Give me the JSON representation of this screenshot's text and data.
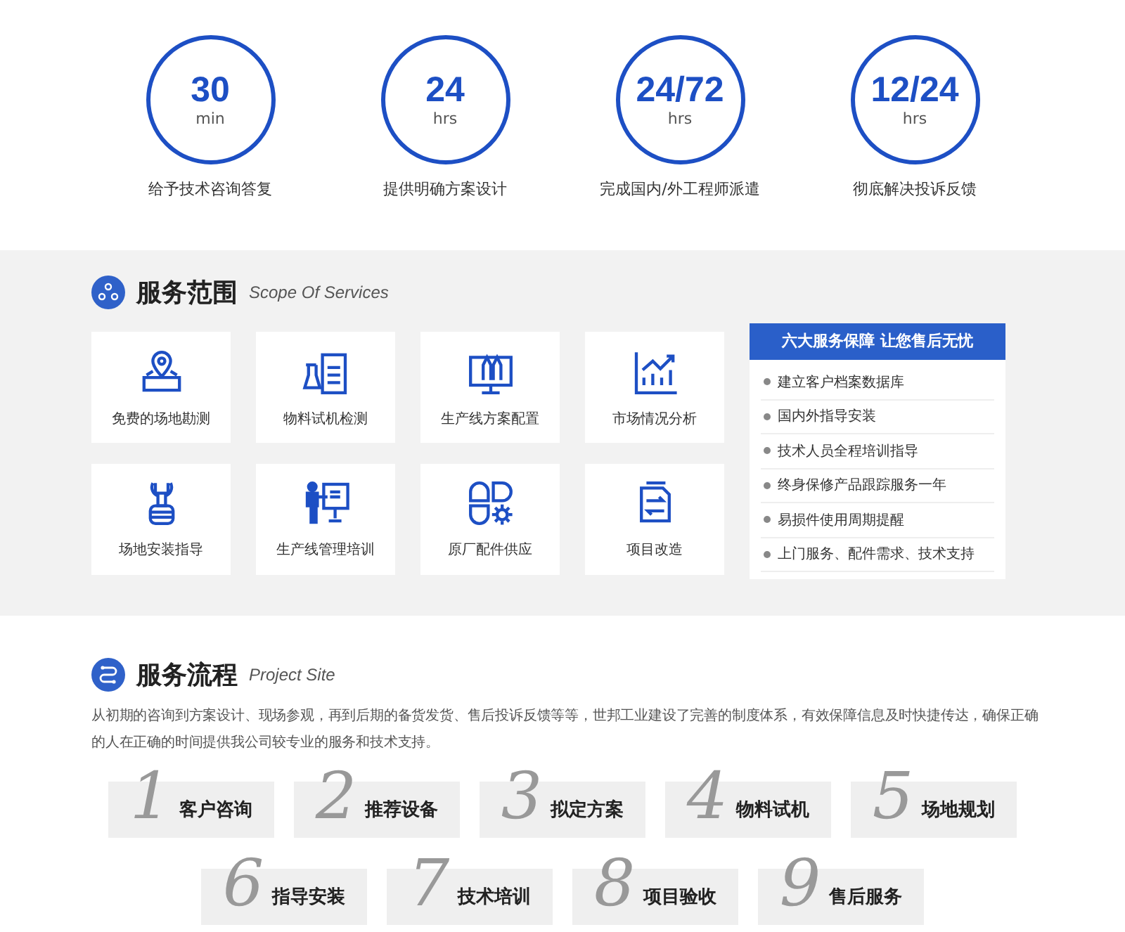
{
  "stats": [
    {
      "value": "30",
      "unit": "min",
      "caption": "给予技术咨询答复"
    },
    {
      "value": "24",
      "unit": "hrs",
      "caption": "提供明确方案设计"
    },
    {
      "value": "24/72",
      "unit": "hrs",
      "caption": "完成国内/外工程师派遣"
    },
    {
      "value": "12/24",
      "unit": "hrs",
      "caption": "彻底解决投诉反馈"
    }
  ],
  "services": {
    "title": "服务范围",
    "subtitle": "Scope Of Services",
    "cards": [
      {
        "label": "免费的场地勘测"
      },
      {
        "label": "物料试机检测"
      },
      {
        "label": "生产线方案配置"
      },
      {
        "label": "市场情况分析"
      },
      {
        "label": "场地安装指导"
      },
      {
        "label": "生产线管理培训"
      },
      {
        "label": "原厂配件供应"
      },
      {
        "label": "项目改造"
      }
    ],
    "guarantee": {
      "title": "六大服务保障 让您售后无忧",
      "items": [
        "建立客户档案数据库",
        "国内外指导安装",
        "技术人员全程培训指导",
        "终身保修产品跟踪服务一年",
        "易损件使用周期提醒",
        "上门服务、配件需求、技术支持"
      ]
    }
  },
  "process": {
    "title": "服务流程",
    "subtitle": "Project Site",
    "description": "从初期的咨询到方案设计、现场参观，再到后期的备货发货、售后投诉反馈等等，世邦工业建设了完善的制度体系，有效保障信息及时快捷传达，确保正确的人在正确的时间提供我公司较专业的服务和技术支持。",
    "rows": [
      [
        {
          "number": "1",
          "label": "客户咨询"
        },
        {
          "number": "2",
          "label": "推荐设备"
        },
        {
          "number": "3",
          "label": "拟定方案"
        },
        {
          "number": "4",
          "label": "物料试机"
        },
        {
          "number": "5",
          "label": "场地规划"
        }
      ],
      [
        {
          "number": "6",
          "label": "指导安装"
        },
        {
          "number": "7",
          "label": "技术培训"
        },
        {
          "number": "8",
          "label": "项目验收"
        },
        {
          "number": "9",
          "label": "售后服务"
        }
      ]
    ]
  }
}
